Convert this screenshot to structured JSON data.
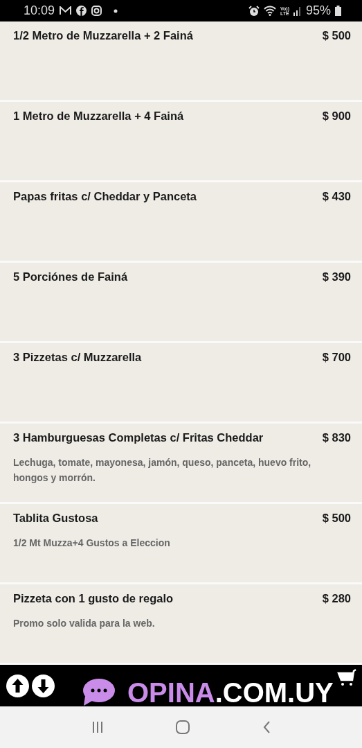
{
  "status_bar": {
    "time": "10:09",
    "volte": "Vo))",
    "lte": "LTE",
    "battery": "95%"
  },
  "items": [
    {
      "name": "1/2 Metro de Muzzarella + 2 Fainá",
      "price": "$ 500"
    },
    {
      "name": "1 Metro de Muzzarella + 4 Fainá",
      "price": "$ 900"
    },
    {
      "name": "Papas fritas c/ Cheddar y Panceta",
      "price": "$ 430"
    },
    {
      "name": "5 Porciónes de Fainá",
      "price": "$ 390"
    },
    {
      "name": "3 Pizzetas c/ Muzzarella",
      "price": "$ 700"
    },
    {
      "name": "3 Hamburguesas Completas c/ Fritas Cheddar",
      "price": "$ 830",
      "description": "Lechuga, tomate, mayonesa, jamón, queso, panceta, huevo frito, hongos y morrón."
    },
    {
      "name": "Tablita Gustosa",
      "price": "$ 500",
      "description": "1/2 Mt Muzza+4 Gustos a Eleccion"
    },
    {
      "name": "Pizzeta con 1 gusto de regalo",
      "price": "$ 280",
      "description": "Promo solo valida para la web."
    }
  ],
  "banner": {
    "brand": "OPINA",
    "domain": ".COM.UY"
  }
}
